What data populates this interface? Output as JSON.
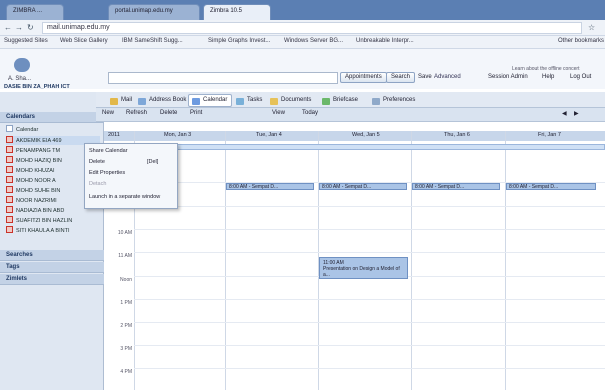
{
  "browser": {
    "tabs": [
      {
        "label": "ZIMBRA ..."
      },
      {
        "label": "portal.unimap.edu.my"
      },
      {
        "label": "Zimbra 10.5"
      }
    ],
    "url": "mail.unimap.edu.my",
    "bookmarks": [
      "Suggested Sites",
      "Web Slice Gallery",
      "IBM SameShift Sugg...",
      "Simple Graphs Invest...",
      "Windows Server BG...",
      "Unbreakable Interpr...",
      "Other bookmarks"
    ]
  },
  "app": {
    "user": "A. Sha...",
    "user_id": "DASIE BIN ZA_PHAH ICT",
    "search_placeholder": "",
    "appointments_btn": "Appointments",
    "search_btn": "Search",
    "save_btn": "Save",
    "advanced_link": "Advanced",
    "header_links": [
      "Session Admin",
      "Help",
      "Log Out"
    ],
    "header_note": "Learn about the offline concert",
    "tabs": [
      "Mail",
      "Address Book",
      "Calendar",
      "Tasks",
      "Documents",
      "Briefcase",
      "Preferences"
    ],
    "toolbar": [
      "New",
      "Refresh",
      "Delete",
      "Print",
      "View",
      "Today"
    ],
    "sidebar": {
      "calendars_header": "Calendars",
      "calendars": [
        "Calendar",
        "AKDEMIK EIA 469",
        "PENAMPANG TM",
        "MOHD HAZIQ BIN",
        "MOHD KHUZAI",
        "MOHD NOOR A",
        "MOHD SUHE BIN",
        "NOOR NAZRIMI",
        "NADIAZIA BIN ABD",
        "SUAFITZI BIN HAZLIN",
        "SITI KHAULA A BINTI"
      ],
      "searches_header": "Searches",
      "tags_header": "Tags",
      "zimlets_header": "Zimlets"
    },
    "context_menu": {
      "items": [
        {
          "label": "Share Calendar",
          "enabled": true
        },
        {
          "label": "Delete",
          "shortcut": "[Del]",
          "enabled": true
        },
        {
          "label": "Edit Properties",
          "enabled": true
        },
        {
          "label": "Detach",
          "enabled": false
        },
        {
          "label": "Launch in a separate window",
          "enabled": true
        }
      ]
    },
    "calendar": {
      "days": [
        "Mon, Jan 3",
        "Tue, Jan 4",
        "Wed, Jan 5",
        "Thu, Jan 6",
        "Fri, Jan 7"
      ],
      "year_label": "2011",
      "allday_event": "Presentation",
      "times": [
        "10 AM",
        "11 AM",
        "Noon",
        "1 PM",
        "2 PM",
        "3 PM",
        "4 PM"
      ],
      "appointments": [
        "8:00 AM - Sempat D...",
        "8:00 AM - Sempat D...",
        "8:00 AM - Sempat D...",
        "8:00 AM - Sempat D..."
      ],
      "big_appt_time": "11:00 AM",
      "big_appt_text": "Presentation on Design a Model of a..."
    }
  }
}
